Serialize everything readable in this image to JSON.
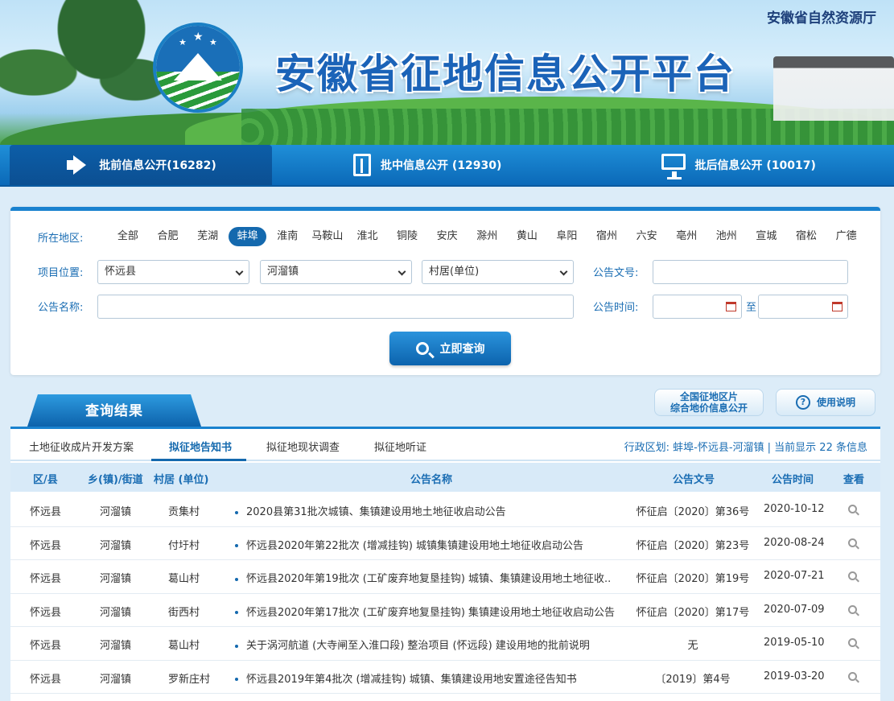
{
  "header": {
    "site_title": "安徽省征地信息公开平台",
    "org_name": "安徽省自然资源厅"
  },
  "nav": [
    {
      "label": "批前信息公开(16282)",
      "icon": "megaphone-icon",
      "active": true
    },
    {
      "label": "批中信息公开 (12930)",
      "icon": "book-icon",
      "active": false
    },
    {
      "label": "批后信息公开 (10017)",
      "icon": "monitor-icon",
      "active": false
    }
  ],
  "search": {
    "region_label": "所在地区:",
    "regions": [
      "全部",
      "合肥",
      "芜湖",
      "蚌埠",
      "淮南",
      "马鞍山",
      "淮北",
      "铜陵",
      "安庆",
      "滁州",
      "黄山",
      "阜阳",
      "宿州",
      "六安",
      "亳州",
      "池州",
      "宣城",
      "宿松",
      "广德"
    ],
    "active_region": "蚌埠",
    "location_label": "项目位置:",
    "county": "怀远县",
    "town": "河溜镇",
    "village": "村居(单位)",
    "doc_no_label": "公告文号:",
    "doc_no_value": "",
    "name_label": "公告名称:",
    "name_value": "",
    "date_label": "公告时间:",
    "date_to": "至",
    "date_from_value": "",
    "date_to_value": "",
    "button_label": "立即查询"
  },
  "results": {
    "title": "查询结果",
    "btn_map_line1": "全国征地区片",
    "btn_map_line2": "综合地价信息公开",
    "btn_help": "使用说明",
    "tabs": [
      "土地征收成片开发方案",
      "拟征地告知书",
      "拟征地现状调查",
      "拟征地听证"
    ],
    "active_tab": 1,
    "region_info": "行政区划: 蚌埠-怀远县-河溜镇  |  当前显示 22 条信息",
    "columns": [
      "区/县",
      "乡(镇)/街道",
      "村居 (单位)",
      "公告名称",
      "公告文号",
      "公告时间",
      "查看"
    ],
    "rows": [
      {
        "county": "怀远县",
        "town": "河溜镇",
        "village": "贡集村",
        "name": "2020县第31批次城镇、集镇建设用地土地征收启动公告",
        "doc": "怀征启〔2020〕第36号",
        "date": "2020-10-12"
      },
      {
        "county": "怀远县",
        "town": "河溜镇",
        "village": "付圩村",
        "name": "怀远县2020年第22批次 (增减挂钩) 城镇集镇建设用地土地征收启动公告",
        "doc": "怀征启〔2020〕第23号",
        "date": "2020-08-24"
      },
      {
        "county": "怀远县",
        "town": "河溜镇",
        "village": "葛山村",
        "name": "怀远县2020年第19批次 (工矿废弃地复垦挂钩) 城镇、集镇建设用地土地征收..",
        "doc": "怀征启〔2020〕第19号",
        "date": "2020-07-21"
      },
      {
        "county": "怀远县",
        "town": "河溜镇",
        "village": "街西村",
        "name": "怀远县2020年第17批次 (工矿废弃地复垦挂钩) 集镇建设用地土地征收启动公告",
        "doc": "怀征启〔2020〕第17号",
        "date": "2020-07-09"
      },
      {
        "county": "怀远县",
        "town": "河溜镇",
        "village": "葛山村",
        "name": "关于涡河航道 (大寺闸至入淮口段) 整治项目 (怀远段) 建设用地的批前说明",
        "doc": "无",
        "date": "2019-05-10"
      },
      {
        "county": "怀远县",
        "town": "河溜镇",
        "village": "罗新庄村",
        "name": "怀远县2019年第4批次 (增减挂钩) 城镇、集镇建设用地安置途径告知书",
        "doc": "〔2019〕第4号",
        "date": "2019-03-20"
      }
    ]
  }
}
